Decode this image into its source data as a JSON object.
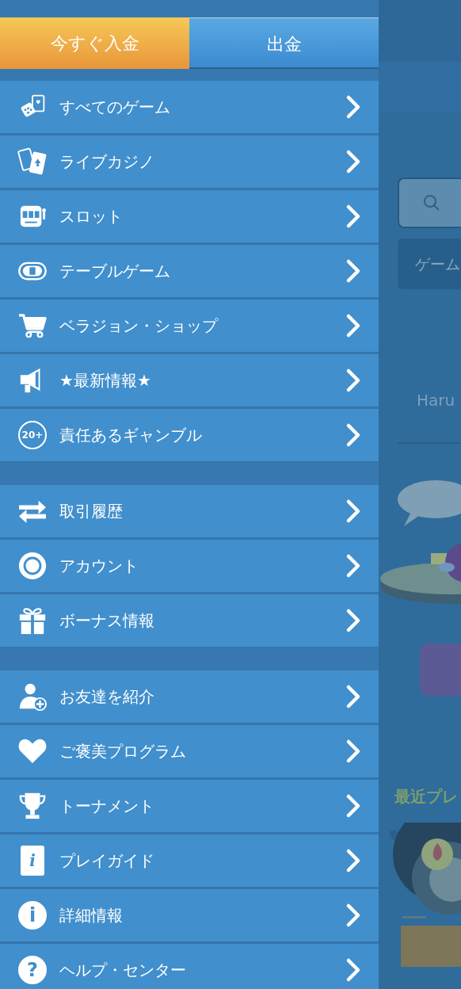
{
  "wallet_buttons": [
    {
      "label": "今すぐ入金",
      "kind": "deposit"
    },
    {
      "label": "出金",
      "kind": "withdraw"
    }
  ],
  "menu_groups": [
    {
      "items": [
        {
          "label": "すべてのゲーム",
          "kind": "games"
        },
        {
          "label": "ライブカジノ",
          "kind": "cards"
        },
        {
          "label": "スロット",
          "kind": "slot"
        },
        {
          "label": "テーブルゲーム",
          "kind": "table"
        },
        {
          "label": "ベラジョン・ショップ",
          "kind": "cart"
        },
        {
          "label": "★最新情報★",
          "kind": "megaphone"
        },
        {
          "label": "責任あるギャンブル",
          "kind": "age",
          "icon_text": "20+"
        }
      ]
    },
    {
      "items": [
        {
          "label": "取引履歴",
          "kind": "transfer"
        },
        {
          "label": "アカウント",
          "kind": "gear"
        },
        {
          "label": "ボーナス情報",
          "kind": "gift"
        }
      ]
    },
    {
      "items": [
        {
          "label": "お友達を紹介",
          "kind": "user-plus"
        },
        {
          "label": "ご褒美プログラム",
          "kind": "heart"
        },
        {
          "label": "トーナメント",
          "kind": "trophy"
        },
        {
          "label": "プレイガイド",
          "kind": "book",
          "icon_text": "i"
        },
        {
          "label": "詳細情報",
          "kind": "info",
          "icon_text": "i"
        },
        {
          "label": "ヘルプ・センター",
          "kind": "help",
          "icon_text": "?"
        }
      ]
    }
  ],
  "background_page": {
    "tab": "ゲーム",
    "username": "Haru",
    "section_title": "最近プレ"
  }
}
